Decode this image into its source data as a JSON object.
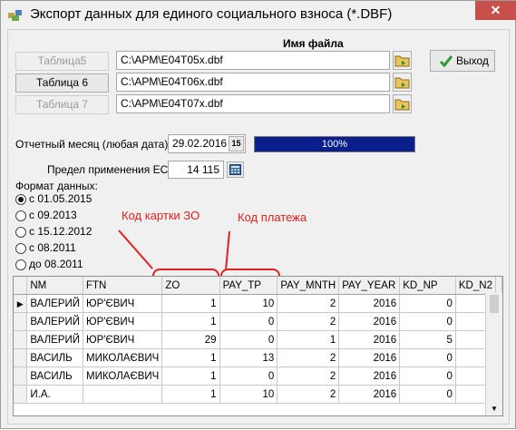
{
  "window": {
    "title": "Экспорт данных для единого социального взноса (*.DBF)",
    "close": "✕"
  },
  "files": {
    "header": "Имя файла",
    "rows": [
      {
        "button": "Таблица5",
        "path": "C:\\APM\\E04T05x.dbf",
        "enabled": false
      },
      {
        "button": "Таблица 6",
        "path": "C:\\APM\\E04T06x.dbf",
        "enabled": true
      },
      {
        "button": "Таблица 7",
        "path": "C:\\APM\\E04T07x.dbf",
        "enabled": false
      }
    ]
  },
  "exit_button": "Выход",
  "month": {
    "label": "Отчетный месяц (любая дата):",
    "value": "29.02.2016",
    "calendar_icon": "15"
  },
  "progress": {
    "percent": 100,
    "text": "100%",
    "color": "#0a1e8c"
  },
  "esv": {
    "label": "Предел применения ЕСВ",
    "value": "14 115"
  },
  "format": {
    "label": "Формат данных:",
    "options": [
      "с 01.05.2015",
      "с 09.2013",
      "с 15.12.2012",
      "с 08.2011",
      "до 08.2011"
    ],
    "selected": 0
  },
  "annotations": {
    "zo": "Код картки ЗО",
    "pay": "Код платежа",
    "color": "#e0201c"
  },
  "grid": {
    "columns": [
      "NM",
      "FTN",
      "ZO",
      "PAY_TP",
      "PAY_MNTH",
      "PAY_YEAR",
      "KD_NP",
      "KD_N2"
    ],
    "rows": [
      [
        "ВАЛЕРИЙ",
        "ЮР'ЄВИЧ",
        "1",
        "10",
        "2",
        "2016",
        "0",
        ""
      ],
      [
        "ВАЛЕРИЙ",
        "ЮР'ЄВИЧ",
        "1",
        "0",
        "2",
        "2016",
        "0",
        ""
      ],
      [
        "ВАЛЕРИЙ",
        "ЮР'ЄВИЧ",
        "29",
        "0",
        "1",
        "2016",
        "5",
        ""
      ],
      [
        "ВАСИЛЬ",
        "МИКОЛАЄВИЧ",
        "1",
        "13",
        "2",
        "2016",
        "0",
        ""
      ],
      [
        "ВАСИЛЬ",
        "МИКОЛАЄВИЧ",
        "1",
        "0",
        "2",
        "2016",
        "0",
        ""
      ],
      [
        "И.А.",
        "",
        "1",
        "10",
        "2",
        "2016",
        "0",
        ""
      ]
    ]
  }
}
